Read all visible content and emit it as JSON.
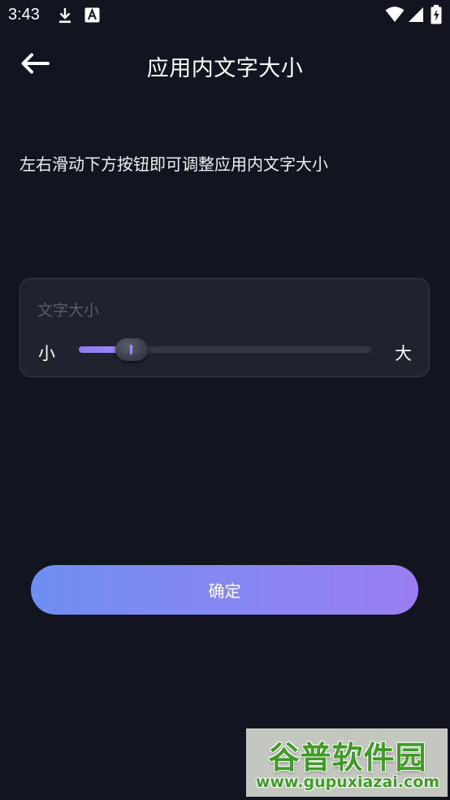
{
  "status_bar": {
    "time": "3:43",
    "icons": [
      "download-icon",
      "accessibility-a-icon",
      "wifi-icon",
      "signal-icon",
      "battery-charging-icon"
    ]
  },
  "header": {
    "title": "应用内文字大小",
    "back_icon": "arrow-left-icon"
  },
  "instruction": "左右滑动下方按钮即可调整应用内文字大小",
  "font_size_card": {
    "label": "文字大小",
    "min_label": "小",
    "max_label": "大",
    "slider_level": 0.18
  },
  "confirm_button": {
    "label": "确定"
  },
  "watermark": {
    "logo_text": "谷普软件园",
    "url": "www.gupuxiazai.com"
  },
  "colors": {
    "background": "#121520",
    "card": "#20222d",
    "accent": "#8c7cf0",
    "button_gradient_start": "#6f8ef2",
    "button_gradient_end": "#9a7ef2"
  }
}
